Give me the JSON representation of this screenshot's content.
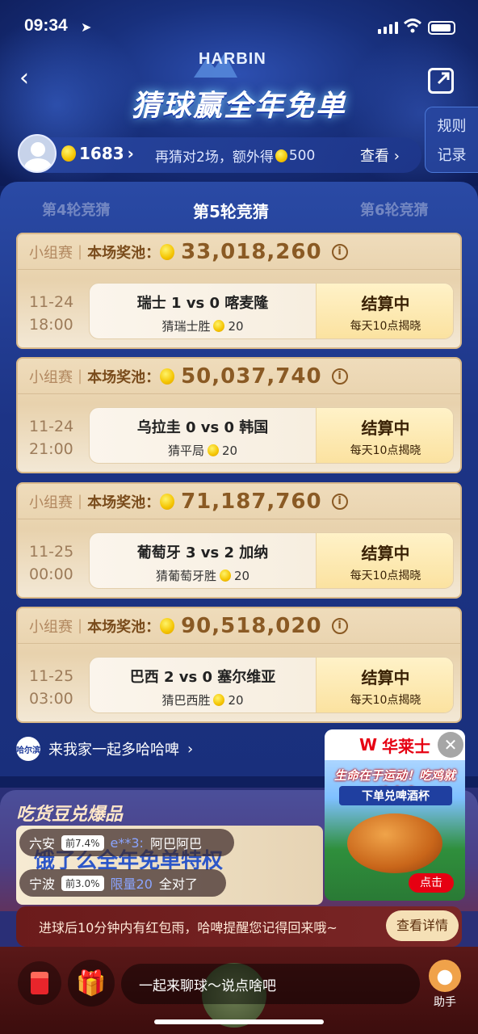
{
  "status_bar": {
    "time": "09:34"
  },
  "header": {
    "brand_logo": "HARBIN",
    "title": "猜球赢全年免单",
    "rules_line1": "规则",
    "rules_line2": "记录"
  },
  "user_bar": {
    "coins": "1683",
    "promo_text": "再猜对2场，额外得",
    "promo_coins": "500",
    "view_label": "查看 ›"
  },
  "rounds": [
    "第4轮竞猜",
    "第5轮竞猜",
    "第6轮竞猜"
  ],
  "active_round_index": 1,
  "pool_label": "本场奖池：",
  "stage_label": "小组赛",
  "matches": [
    {
      "pool": "33,018,260",
      "date": "11-24",
      "time": "18:00",
      "teams": "瑞士 1 vs 0 喀麦隆",
      "pick": "猜瑞士胜",
      "stake": "20",
      "status": "结算中",
      "reveal": "每天10点揭晓"
    },
    {
      "pool": "50,037,740",
      "date": "11-24",
      "time": "21:00",
      "teams": "乌拉圭 0 vs 0 韩国",
      "pick": "猜平局",
      "stake": "20",
      "status": "结算中",
      "reveal": "每天10点揭晓"
    },
    {
      "pool": "71,187,760",
      "date": "11-25",
      "time": "00:00",
      "teams": "葡萄牙 3 vs 2 加纳",
      "pick": "猜葡萄牙胜",
      "stake": "20",
      "status": "结算中",
      "reveal": "每天10点揭晓"
    },
    {
      "pool": "90,518,020",
      "date": "11-25",
      "time": "03:00",
      "teams": "巴西 2 vs 0 塞尔维亚",
      "pick": "猜巴西胜",
      "stake": "20",
      "status": "结算中",
      "reveal": "每天10点揭晓"
    }
  ],
  "brand_link": "来我家一起多哈哈啤",
  "brand_icon": "哈尔滨",
  "foodie": {
    "title": "吃货豆兑爆品",
    "prize_text": "饿了么全年免单特权"
  },
  "tickers": [
    {
      "city": "六安",
      "badge": "前7.4%",
      "name": "e**3:",
      "msg": "阿巴阿巴"
    },
    {
      "city": "宁波",
      "badge": "前3.0%",
      "name": "限量20",
      "msg": "全对了"
    }
  ],
  "ad": {
    "brand": "华莱士",
    "slogan": "生命在于运动！吃鸡就吃全鸡",
    "sub": "下单兑啤酒杯",
    "click_label": "点击"
  },
  "notice": {
    "text": "进球后10分钟内有红包雨，哈啤提醒您记得回来哦~",
    "button": "查看详情"
  },
  "chat": {
    "placeholder": "一起来聊球～说点啥吧",
    "helper_label": "助手"
  }
}
